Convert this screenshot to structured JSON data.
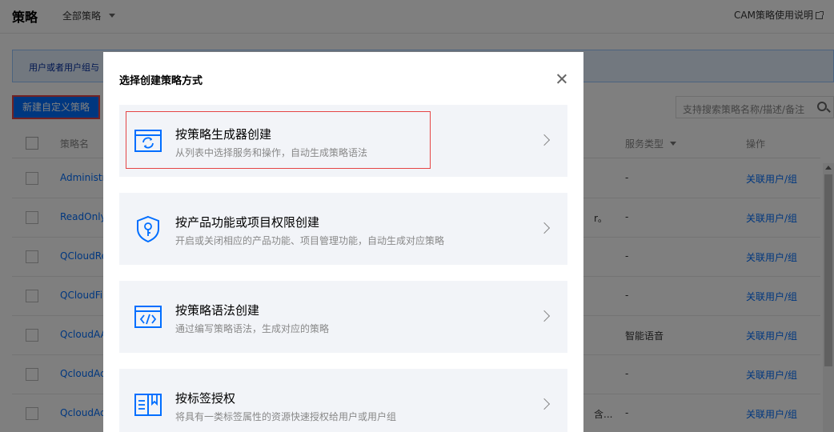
{
  "topbar": {
    "title": "策略",
    "scope": "全部策略",
    "doc_link": "CAM策略使用说明"
  },
  "notice": {
    "text": "用户或者用户组与"
  },
  "toolbar": {
    "new_policy_label": "新建自定义策略",
    "search_placeholder": "支持搜索策略名称/描述/备注"
  },
  "table": {
    "headers": {
      "name": "策略名",
      "service": "服务类型",
      "operation": "操作"
    },
    "rows": [
      {
        "name": "Administra",
        "desc": "",
        "service": "-",
        "op": "关联用户/组"
      },
      {
        "name": "ReadOnly",
        "desc": "r。",
        "service": "-",
        "op": "关联用户/组"
      },
      {
        "name": "QCloudRe",
        "desc": "",
        "service": "-",
        "op": "关联用户/组"
      },
      {
        "name": "QCloudFin",
        "desc": "",
        "service": "-",
        "op": "关联用户/组"
      },
      {
        "name": "QcloudAA",
        "desc": "",
        "service": "智能语音",
        "op": "关联用户/组"
      },
      {
        "name": "QcloudAc",
        "desc": "",
        "service": "-",
        "op": "关联用户/组"
      },
      {
        "name": "QcloudAc",
        "desc": "含...",
        "service": "-",
        "op": "关联用户/组"
      }
    ]
  },
  "modal": {
    "title": "选择创建策略方式",
    "options": [
      {
        "title": "按策略生成器创建",
        "desc": "从列表中选择服务和操作，自动生成策略语法",
        "icon": "policy-generator-icon"
      },
      {
        "title": "按产品功能或项目权限创建",
        "desc": "开启或关闭相应的产品功能、项目管理功能，自动生成对应策略",
        "icon": "shield-key-icon"
      },
      {
        "title": "按策略语法创建",
        "desc": "通过编写策略语法，生成对应的策略",
        "icon": "code-window-icon"
      },
      {
        "title": "按标签授权",
        "desc": "将具有一类标签属性的资源快速授权给用户或用户组",
        "icon": "tag-book-icon"
      }
    ]
  },
  "colors": {
    "accent": "#006eff",
    "highlight_border": "#e54545",
    "option_bg": "#f2f4f8",
    "icon_blue": "#006eff"
  }
}
